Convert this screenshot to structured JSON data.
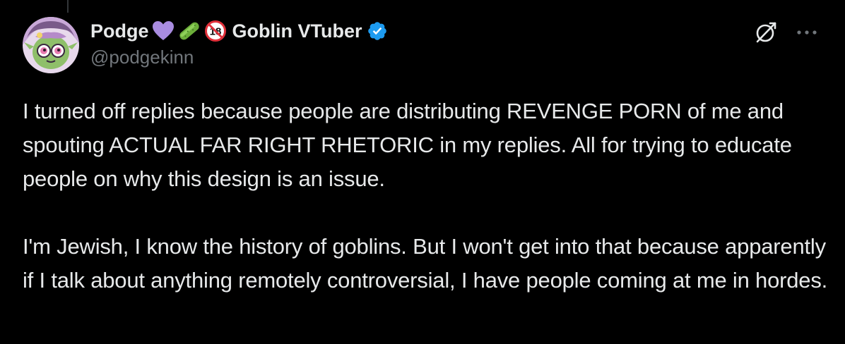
{
  "author": {
    "display_name": "Podge",
    "name_suffix": "Goblin VTuber",
    "handle": "@podgekinn",
    "emojis": [
      "purple-heart",
      "cucumber",
      "no-one-under-eighteen"
    ],
    "age_badge_text": "18",
    "verified": true,
    "verified_color": "#1d9bf0"
  },
  "tweet": {
    "paragraphs": [
      "I turned off replies because people are distributing REVENGE PORN of me and spouting ACTUAL FAR RIGHT RHETORIC in my replies. All for trying to educate people on why this design is an issue.",
      "I'm Jewish, I know the history of goblins. But I won't get into that because apparently if I talk about anything remotely controversial, I have people coming at me in hordes."
    ]
  },
  "actions": {
    "grok_icon": "grok-icon",
    "more_icon": "more-options-icon"
  },
  "colors": {
    "background": "#000000",
    "text_primary": "#e7e9ea",
    "text_secondary": "#71767b",
    "accent": "#1d9bf0"
  }
}
